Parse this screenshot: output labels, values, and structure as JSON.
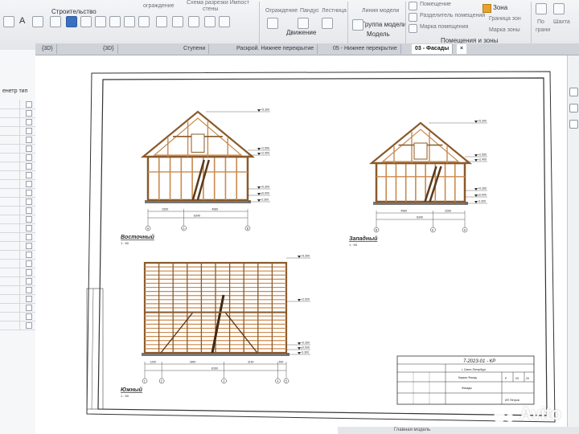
{
  "ribbon": {
    "tab_label": "Строительство",
    "labels": {
      "ograzhdenie": "ограждение",
      "shema": "Схема разрезки Импост",
      "steny": "стены",
      "ograzhdenie2": "Ограждение",
      "pandus": "Пандус",
      "lestnitsa": "Лестница",
      "liniya_modeli": "Линия модели",
      "gruppa_modeli": "Группа модели",
      "pomeschenie": "Помещение",
      "razdelitel": "Разделитель помещений",
      "marka_pomescheniya": "Марка помещения",
      "zona": "Зона",
      "granitsa_zon": "Граница зон",
      "marka_zony": "Марка зоны",
      "po": "По",
      "shakhta": "Шахта",
      "grani": "грани"
    },
    "groups": {
      "dvizhenie": "Движение",
      "model": "Модель",
      "pomescheniya": "Помещения и зоны"
    }
  },
  "palette": {
    "title": "енетр тип"
  },
  "tabs": [
    {
      "label": "{3D}"
    },
    {
      "label": "{3D}"
    },
    {
      "label": "Ступени"
    },
    {
      "label": "Раскрой. Нижнее перекрытие"
    },
    {
      "label": "05 - Нижнее перекрытие"
    },
    {
      "label": "03 - Фасады"
    }
  ],
  "sheet": {
    "elevations": {
      "east": {
        "title": "Восточный",
        "scale": "1 : 50",
        "levels": [
          "+5.300",
          "+2.550",
          "+2.400",
          "+0.300",
          "±0.000",
          "-0.300"
        ],
        "dims": [
          "2260",
          "4080",
          "6340"
        ],
        "axes": [
          "A",
          "Б",
          "В"
        ]
      },
      "west": {
        "title": "Западный",
        "scale": "1 : 50",
        "levels": [
          "+5.300",
          "+2.550",
          "+2.400",
          "+0.300",
          "±0.000",
          "-0.300"
        ],
        "dims": [
          "4080",
          "2260",
          "6340"
        ],
        "axes": [
          "B",
          "Б",
          "A"
        ]
      },
      "south": {
        "title": "Южный",
        "scale": "1 : 50",
        "levels": [
          "+5.300",
          "+2.520",
          "+0.300",
          "±0.000",
          "-0.300"
        ],
        "dims": [
          "1260",
          "2840",
          "3160",
          "600",
          "8160"
        ],
        "axes": [
          "1",
          "2",
          "3",
          "4",
          "5"
        ]
      }
    },
    "title_block": {
      "code": "7-2023-01 - КР",
      "city": "г. Санкт-Петербург",
      "subject": "Каркас Фасад",
      "stage": "Р",
      "sheet": "03",
      "sheets": "20",
      "part": "Фасады",
      "company": "ИП Петров"
    }
  },
  "status": {
    "label": "Главная модель"
  },
  "watermark": {
    "brand": "Avito"
  }
}
